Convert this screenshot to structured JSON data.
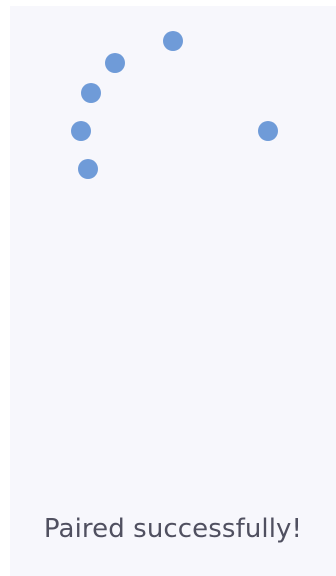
{
  "status": {
    "message": "Paired successfully!"
  },
  "indicator": {
    "type": "spinner",
    "color": "#6f9bd8"
  }
}
